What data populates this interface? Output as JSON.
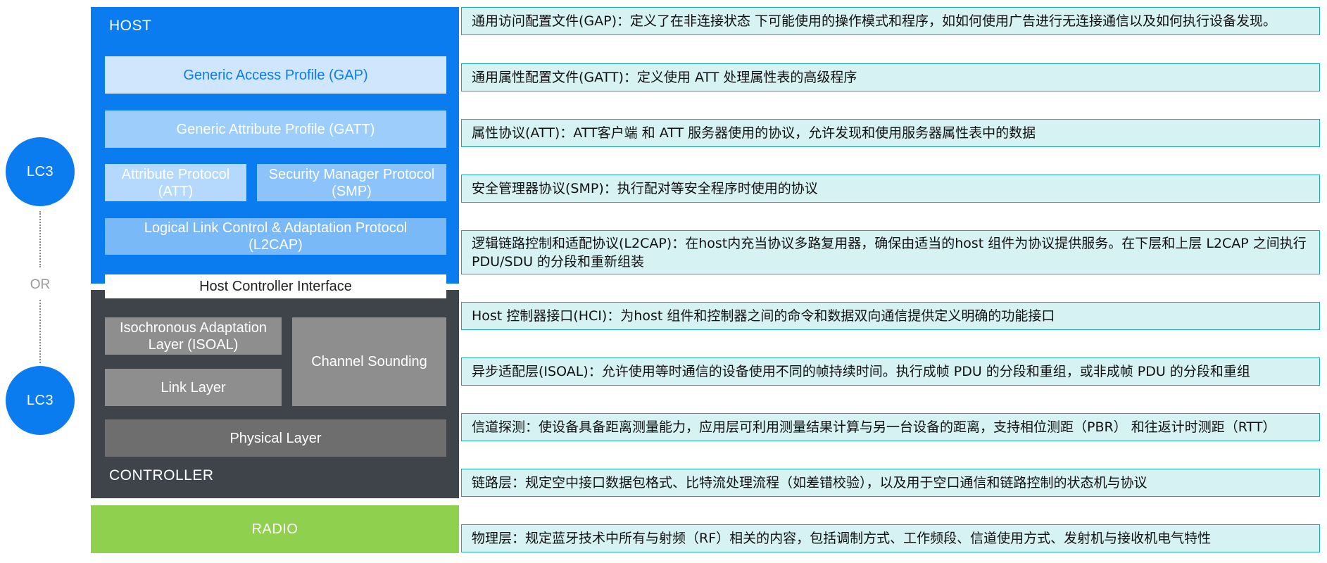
{
  "left_column": {
    "lc3_top": "LC3",
    "or": "OR",
    "lc3_bottom": "LC3"
  },
  "stack": {
    "host_label": "HOST",
    "gap": "Generic Access Profile (GAP)",
    "gatt": "Generic Attribute Profile (GATT)",
    "att": "Attribute Protocol\n(ATT)",
    "smp": "Security Manager Protocol\n(SMP)",
    "l2cap": "Logical Link Control & Adaptation Protocol\n(L2CAP)",
    "hci": "Host Controller Interface",
    "isoal": "Isochronous Adaptation\nLayer (ISOAL)",
    "link_layer": "Link Layer",
    "channel_sounding": "Channel Sounding",
    "physical_layer": "Physical Layer",
    "controller_label": "CONTROLLER",
    "radio_label": "RADIO"
  },
  "descriptions": [
    "通用访问配置文件(GAP)：定义了在非连接状态 下可能使用的操作模式和程序，如如何使用广告进行无连接通信以及如何执行设备发现。",
    "通用属性配置文件(GATT)：定义使用 ATT 处理属性表的高级程序",
    "属性协议(ATT)：ATT客户端 和 ATT 服务器使用的协议，允许发现和使用服务器属性表中的数据",
    "安全管理器协议(SMP)：执行配对等安全程序时使用的协议",
    "逻辑链路控制和适配协议(L2CAP)：在host内充当协议多路复用器，确保由适当的host 组件为协议提供服务。在下层和上层 L2CAP 之间执行 PDU/SDU 的分段和重新组装",
    "Host 控制器接口(HCI)：为host 组件和控制器之间的命令和数据双向通信提供定义明确的功能接口",
    "异步适配层(ISOAL)：允许使用等时通信的设备使用不同的帧持续时间。执行成帧 PDU 的分段和重组，或非成帧 PDU 的分段和重组",
    "信道探测：使设备具备距离测量能力，应用层可利用测量结果计算与另一台设备的距离，支持相位测距（PBR） 和往返计时测距（RTT）",
    "链路层：规定空中接口数据包格式、比特流处理流程（如差错校验），以及用于空口通信和链路控制的状态机与协议",
    "物理层：规定蓝牙技术中所有与射频（RF）相关的内容，包括调制方式、工作频段、信道使用方式、发射机与接收机电气特性"
  ],
  "colors": {
    "host": "#0a7cf0",
    "controller": "#3f444b",
    "radio": "#8fd14f",
    "description_fill": "#d6f2f2",
    "description_border": "#1fa6a6"
  }
}
